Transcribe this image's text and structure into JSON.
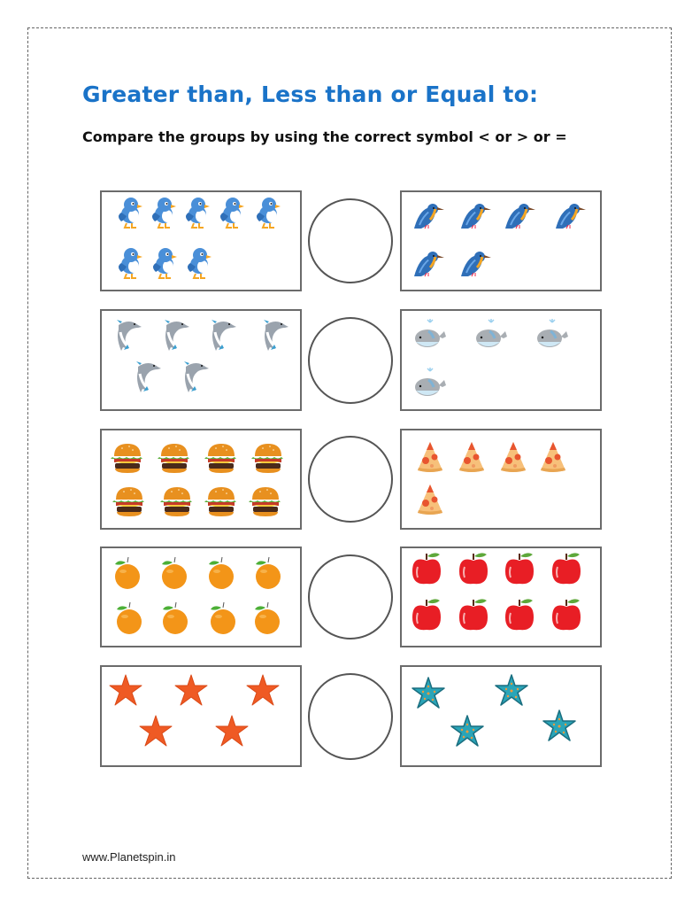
{
  "worksheet": {
    "title": "Greater than, Less than or Equal to:",
    "instruction": "Compare the groups by using the correct symbol < or > or =",
    "footer": "www.Planetspin.in",
    "title_color": "#1a73c8",
    "answer_symbols": [
      "<",
      ">",
      "="
    ]
  },
  "rows": [
    {
      "left": {
        "item": "blue-bird",
        "count": 8
      },
      "right": {
        "item": "kingfisher",
        "count": 6
      },
      "answer": ""
    },
    {
      "left": {
        "item": "dolphin",
        "count": 6
      },
      "right": {
        "item": "whale",
        "count": 4
      },
      "answer": ""
    },
    {
      "left": {
        "item": "burger",
        "count": 8
      },
      "right": {
        "item": "pizza-slice",
        "count": 5
      },
      "answer": ""
    },
    {
      "left": {
        "item": "orange",
        "count": 8
      },
      "right": {
        "item": "apple",
        "count": 8
      },
      "answer": ""
    },
    {
      "left": {
        "item": "orange-starfish",
        "count": 5
      },
      "right": {
        "item": "teal-starfish",
        "count": 4
      },
      "answer": ""
    }
  ]
}
